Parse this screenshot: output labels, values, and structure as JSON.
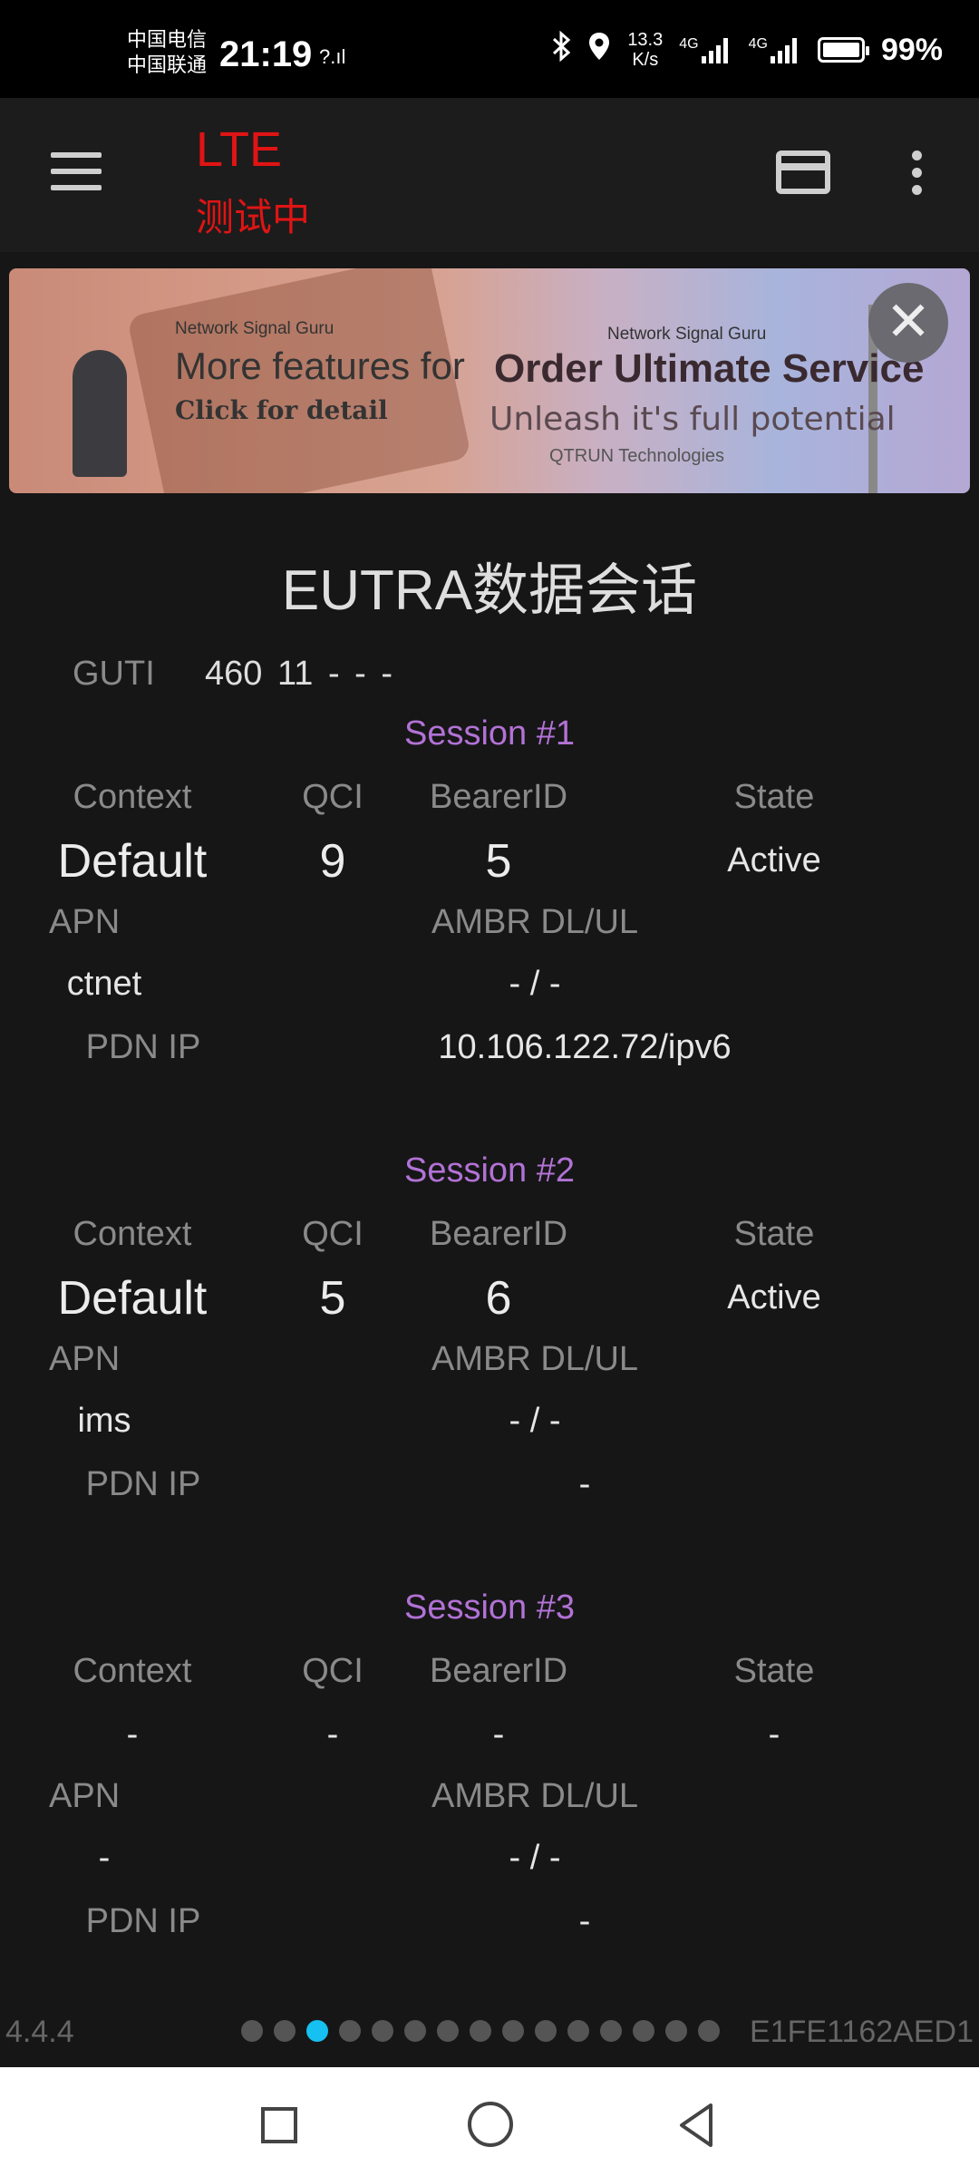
{
  "status_bar": {
    "carrier_1": "中国电信",
    "carrier_2": "中国联通",
    "time": "21:19",
    "signal_small": "?.ıl",
    "speed_value": "13.3",
    "speed_unit": "K/s",
    "network_1": "4G",
    "network_2": "4G",
    "battery_percent": "99%",
    "icons": [
      "bluetooth-icon",
      "location-icon",
      "signal-icon",
      "battery-icon"
    ]
  },
  "toolbar": {
    "title": "LTE",
    "subtitle": "测试中",
    "icons": [
      "menu-icon",
      "card-icon",
      "more-vert-icon"
    ]
  },
  "banner": {
    "left_brand": "Network Signal Guru",
    "left_main": "More features for",
    "left_sub": "Click for detail",
    "right_brand": "Network Signal Guru",
    "right_main": "Order Ultimate Service",
    "right_sub": "Unleash it's full potential",
    "company": "QTRUN Technologies",
    "close_glyph": "✕"
  },
  "page": {
    "title": "EUTRA数据会话",
    "guti_label": "GUTI",
    "guti_value": "460 11 - - -"
  },
  "labels": {
    "context": "Context",
    "qci": "QCI",
    "bearer_id": "BearerID",
    "state": "State",
    "apn": "APN",
    "ambr": "AMBR DL/UL",
    "pdn_ip": "PDN IP"
  },
  "sessions": [
    {
      "title": "Session #1",
      "context": "Default",
      "qci": "9",
      "bearer_id": "5",
      "state": "Active",
      "apn": "ctnet",
      "ambr": "- / -",
      "pdn_ip": "10.106.122.72/ipv6"
    },
    {
      "title": "Session #2",
      "context": "Default",
      "qci": "5",
      "bearer_id": "6",
      "state": "Active",
      "apn": "ims",
      "ambr": "- / -",
      "pdn_ip": "-"
    },
    {
      "title": "Session #3",
      "context": "-",
      "qci": "-",
      "bearer_id": "-",
      "state": "-",
      "apn": "-",
      "ambr": "- / -",
      "pdn_ip": "-"
    }
  ],
  "footer": {
    "version": "4.4.4",
    "device_id": "E1FE1162AED1",
    "page_count": 15,
    "active_page": 3,
    "active_dot_color": "#16c0f0"
  },
  "nav_bar": {
    "icons": [
      "recents-icon",
      "home-icon",
      "back-icon"
    ]
  }
}
